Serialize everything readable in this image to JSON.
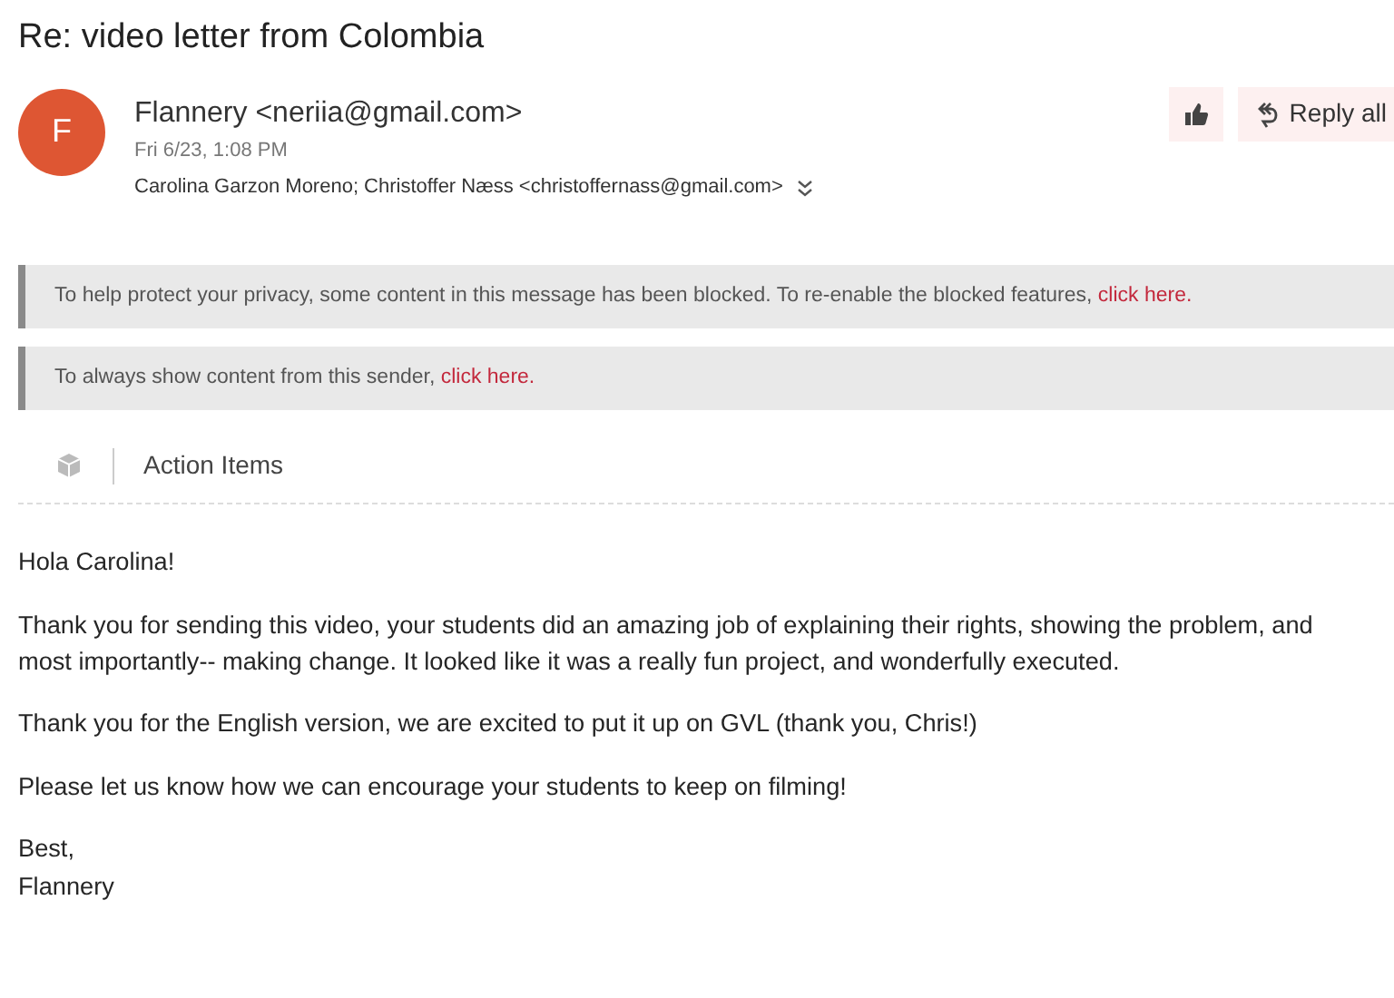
{
  "subject": "Re: video letter from Colombia",
  "sender": {
    "initial": "F",
    "name": "Flannery <neriia@gmail.com>",
    "date": "Fri 6/23, 1:08 PM",
    "recipients": "Carolina Garzon Moreno; Christoffer Næss <christoffernass@gmail.com>"
  },
  "actions": {
    "reply_all": "Reply all"
  },
  "notices": [
    {
      "text": "To help protect your privacy, some content in this message has been blocked. To re-enable the blocked features, ",
      "link": "click here."
    },
    {
      "text": "To always show content from this sender, ",
      "link": "click here."
    }
  ],
  "addin": {
    "label": "Action Items"
  },
  "body": [
    "Hola Carolina!",
    "Thank you for sending this video, your students did an amazing job of explaining their rights, showing the problem, and most importantly-- making change. It looked like it was a really fun project, and wonderfully executed.",
    "Thank you for the English version, we are excited to put it up on GVL (thank you, Chris!)",
    "Please let us know how we can encourage your students to keep on filming!"
  ],
  "signoff": [
    "Best,",
    "Flannery"
  ]
}
